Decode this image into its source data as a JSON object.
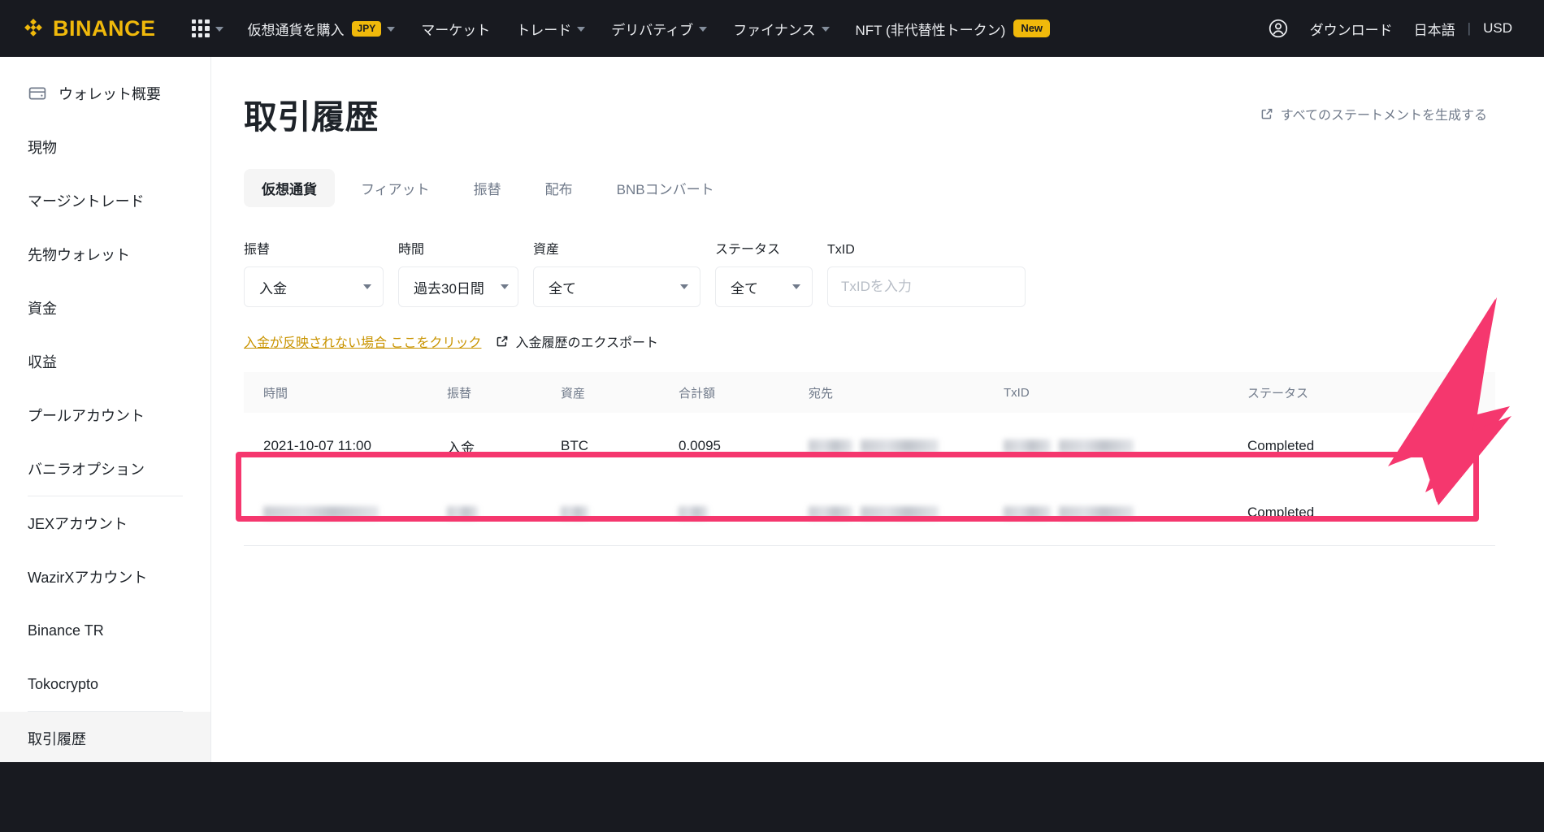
{
  "navbar": {
    "brand": "BINANCE",
    "grid_icon": "apps-grid-icon",
    "items": [
      {
        "label": "仮想通貨を購入",
        "badge": "JPY",
        "caret": true
      },
      {
        "label": "マーケット",
        "caret": false
      },
      {
        "label": "トレード",
        "caret": true
      },
      {
        "label": "デリバティブ",
        "caret": true
      },
      {
        "label": "ファイナンス",
        "caret": true
      },
      {
        "label": "NFT (非代替性トークン)",
        "badge_new": "New",
        "caret": false
      }
    ],
    "right": {
      "user_icon": "user-circle-icon",
      "download": "ダウンロード",
      "language": "日本語",
      "separator": "|",
      "currency": "USD"
    }
  },
  "sidebar": {
    "items": [
      {
        "label": "ウォレット概要",
        "icon": "wallet-icon",
        "active": false
      },
      {
        "label": "現物",
        "active": false
      },
      {
        "label": "マージントレード",
        "active": false
      },
      {
        "label": "先物ウォレット",
        "active": false
      },
      {
        "label": "資金",
        "active": false
      },
      {
        "label": "収益",
        "active": false
      },
      {
        "label": "プールアカウント",
        "active": false
      },
      {
        "label": "バニラオプション",
        "active": false
      },
      {
        "label": "JEXアカウント",
        "active": false
      },
      {
        "label": "WazirXアカウント",
        "active": false
      },
      {
        "label": "Binance TR",
        "active": false
      },
      {
        "label": "Tokocrypto",
        "active": false
      },
      {
        "label": "取引履歴",
        "active": true
      }
    ]
  },
  "main": {
    "page_title": "取引履歴",
    "generate_statement": "すべてのステートメントを生成する",
    "tabs": [
      {
        "label": "仮想通貨",
        "active": true
      },
      {
        "label": "フィアット",
        "active": false
      },
      {
        "label": "振替",
        "active": false
      },
      {
        "label": "配布",
        "active": false
      },
      {
        "label": "BNBコンバート",
        "active": false
      }
    ],
    "filters": [
      {
        "label": "振替",
        "value": "入金",
        "type": "select"
      },
      {
        "label": "時間",
        "value": "過去30日間",
        "type": "select"
      },
      {
        "label": "資産",
        "value": "全て",
        "type": "select"
      },
      {
        "label": "ステータス",
        "value": "全て",
        "type": "select"
      },
      {
        "label": "TxID",
        "value": "",
        "placeholder": "TxIDを入力",
        "type": "input"
      }
    ],
    "links": {
      "deposit_help": "入金が反映されない場合 ここをクリック",
      "export": "入金履歴のエクスポート"
    },
    "table": {
      "columns": [
        "時間",
        "振替",
        "資産",
        "合計額",
        "宛先",
        "TxID",
        "ステータス"
      ],
      "rows": [
        {
          "time": "2021-10-07 11:00",
          "transfer": "入金",
          "asset": "BTC",
          "amount": "0.0095",
          "destination": "",
          "txid": "",
          "status": "Completed",
          "highlighted": true,
          "redacted": [
            "destination",
            "txid"
          ]
        },
        {
          "time": "",
          "transfer": "",
          "asset": "",
          "amount": "",
          "destination": "",
          "txid": "",
          "status": "Completed",
          "highlighted": false,
          "redacted": [
            "time",
            "transfer",
            "asset",
            "amount",
            "destination",
            "txid"
          ]
        }
      ]
    }
  },
  "annotations": {
    "highlight_color": "#f5376e",
    "arrow_color": "#f5376e",
    "arrow_name": "pink-annotation-arrow",
    "box_name": "pink-annotation-box"
  },
  "colors": {
    "brand_yellow": "#f0b90b",
    "nav_bg": "#181a20",
    "text_primary": "#1e2329",
    "text_secondary": "#707a8a",
    "border": "#eaecef",
    "accent_pink": "#f5376e"
  }
}
